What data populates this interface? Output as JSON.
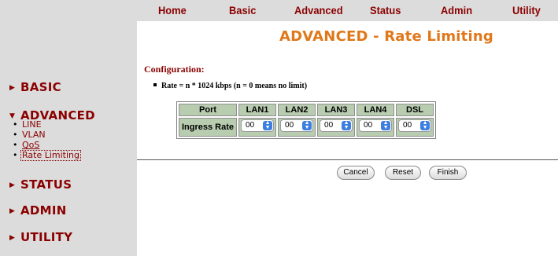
{
  "topnav": [
    "Home",
    "Basic",
    "Advanced",
    "Status",
    "Admin",
    "Utility"
  ],
  "title": "ADVANCED - Rate Limiting",
  "sidebar": {
    "basic": "BASIC",
    "advanced": "ADVANCED",
    "advanced_items": [
      "LINE",
      "VLAN",
      "QoS",
      "Rate Limiting"
    ],
    "status": "STATUS",
    "admin": "ADMIN",
    "utility": "UTILITY"
  },
  "config": {
    "label": "Configuration:",
    "note": "Rate = n * 1024 kbps (n = 0 means no limit)"
  },
  "table": {
    "headers": [
      "Port",
      "LAN1",
      "LAN2",
      "LAN3",
      "LAN4",
      "DSL"
    ],
    "row_label": "Ingress Rate",
    "values": [
      "00",
      "00",
      "00",
      "00",
      "00"
    ]
  },
  "buttons": {
    "cancel": "Cancel",
    "reset": "Reset",
    "finish": "Finish"
  },
  "colors": {
    "brand": "#8b0000",
    "title": "#e0781a",
    "panel": "#dcdcdc",
    "table": "#b8ccb0",
    "select_arrow": "#3d7fe0"
  }
}
